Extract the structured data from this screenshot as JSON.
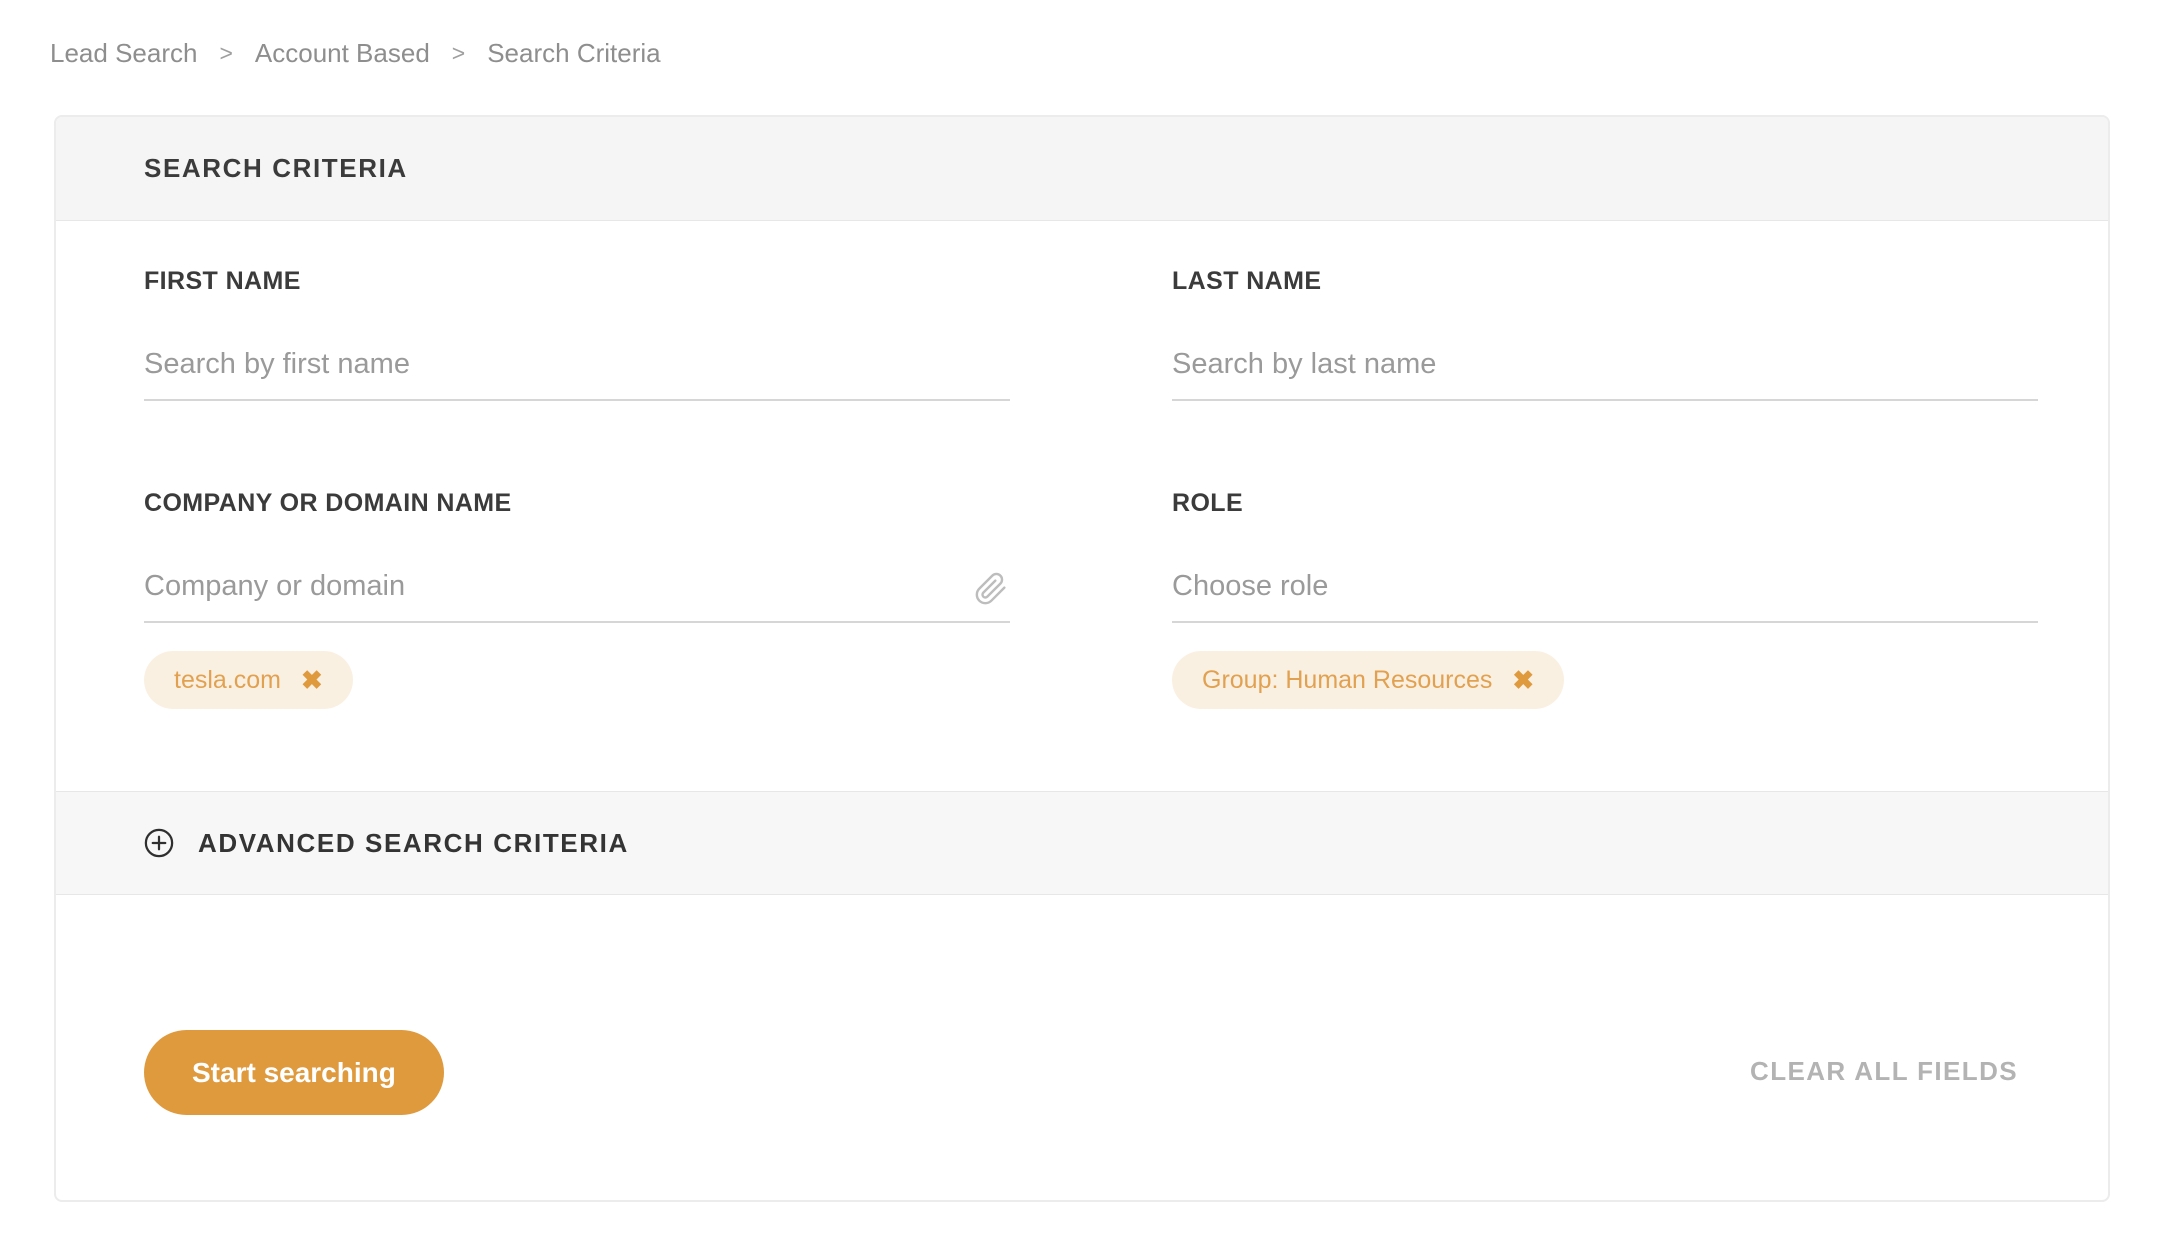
{
  "breadcrumb": {
    "separator": ">",
    "items": [
      {
        "label": "Lead Search"
      },
      {
        "label": "Account Based"
      },
      {
        "label": "Search Criteria"
      }
    ]
  },
  "panel": {
    "title": "SEARCH CRITERIA",
    "fields": {
      "first_name": {
        "label": "FIRST NAME",
        "placeholder": "Search by first name",
        "value": ""
      },
      "last_name": {
        "label": "LAST NAME",
        "placeholder": "Search by last name",
        "value": ""
      },
      "company": {
        "label": "COMPANY OR DOMAIN NAME",
        "placeholder": "Company or domain",
        "value": "",
        "tag": {
          "label": "tesla.com",
          "remove_glyph": "✖"
        }
      },
      "role": {
        "label": "ROLE",
        "placeholder": "Choose role",
        "value": "",
        "tag": {
          "label": "Group: Human Resources",
          "remove_glyph": "✖"
        }
      }
    },
    "advanced": {
      "label": "ADVANCED SEARCH CRITERIA"
    },
    "footer": {
      "start_button": "Start searching",
      "clear_all": "CLEAR ALL FIELDS"
    }
  },
  "colors": {
    "accent_orange": "#DF9A3E",
    "tag_background": "#FAF0E2",
    "tag_text": "#E1A150",
    "header_background": "#F5F5F5",
    "card_border": "#ECECEC"
  }
}
